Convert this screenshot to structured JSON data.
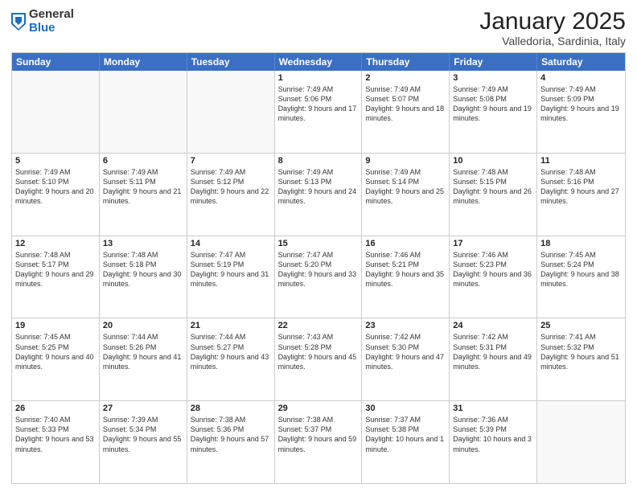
{
  "header": {
    "logo_general": "General",
    "logo_blue": "Blue",
    "month_title": "January 2025",
    "subtitle": "Valledoria, Sardinia, Italy"
  },
  "weekdays": [
    "Sunday",
    "Monday",
    "Tuesday",
    "Wednesday",
    "Thursday",
    "Friday",
    "Saturday"
  ],
  "weeks": [
    [
      {
        "day": "",
        "text": ""
      },
      {
        "day": "",
        "text": ""
      },
      {
        "day": "",
        "text": ""
      },
      {
        "day": "1",
        "text": "Sunrise: 7:49 AM\nSunset: 5:06 PM\nDaylight: 9 hours and 17 minutes."
      },
      {
        "day": "2",
        "text": "Sunrise: 7:49 AM\nSunset: 5:07 PM\nDaylight: 9 hours and 18 minutes."
      },
      {
        "day": "3",
        "text": "Sunrise: 7:49 AM\nSunset: 5:08 PM\nDaylight: 9 hours and 19 minutes."
      },
      {
        "day": "4",
        "text": "Sunrise: 7:49 AM\nSunset: 5:09 PM\nDaylight: 9 hours and 19 minutes."
      }
    ],
    [
      {
        "day": "5",
        "text": "Sunrise: 7:49 AM\nSunset: 5:10 PM\nDaylight: 9 hours and 20 minutes."
      },
      {
        "day": "6",
        "text": "Sunrise: 7:49 AM\nSunset: 5:11 PM\nDaylight: 9 hours and 21 minutes."
      },
      {
        "day": "7",
        "text": "Sunrise: 7:49 AM\nSunset: 5:12 PM\nDaylight: 9 hours and 22 minutes."
      },
      {
        "day": "8",
        "text": "Sunrise: 7:49 AM\nSunset: 5:13 PM\nDaylight: 9 hours and 24 minutes."
      },
      {
        "day": "9",
        "text": "Sunrise: 7:49 AM\nSunset: 5:14 PM\nDaylight: 9 hours and 25 minutes."
      },
      {
        "day": "10",
        "text": "Sunrise: 7:48 AM\nSunset: 5:15 PM\nDaylight: 9 hours and 26 minutes."
      },
      {
        "day": "11",
        "text": "Sunrise: 7:48 AM\nSunset: 5:16 PM\nDaylight: 9 hours and 27 minutes."
      }
    ],
    [
      {
        "day": "12",
        "text": "Sunrise: 7:48 AM\nSunset: 5:17 PM\nDaylight: 9 hours and 29 minutes."
      },
      {
        "day": "13",
        "text": "Sunrise: 7:48 AM\nSunset: 5:18 PM\nDaylight: 9 hours and 30 minutes."
      },
      {
        "day": "14",
        "text": "Sunrise: 7:47 AM\nSunset: 5:19 PM\nDaylight: 9 hours and 31 minutes."
      },
      {
        "day": "15",
        "text": "Sunrise: 7:47 AM\nSunset: 5:20 PM\nDaylight: 9 hours and 33 minutes."
      },
      {
        "day": "16",
        "text": "Sunrise: 7:46 AM\nSunset: 5:21 PM\nDaylight: 9 hours and 35 minutes."
      },
      {
        "day": "17",
        "text": "Sunrise: 7:46 AM\nSunset: 5:23 PM\nDaylight: 9 hours and 36 minutes."
      },
      {
        "day": "18",
        "text": "Sunrise: 7:45 AM\nSunset: 5:24 PM\nDaylight: 9 hours and 38 minutes."
      }
    ],
    [
      {
        "day": "19",
        "text": "Sunrise: 7:45 AM\nSunset: 5:25 PM\nDaylight: 9 hours and 40 minutes."
      },
      {
        "day": "20",
        "text": "Sunrise: 7:44 AM\nSunset: 5:26 PM\nDaylight: 9 hours and 41 minutes."
      },
      {
        "day": "21",
        "text": "Sunrise: 7:44 AM\nSunset: 5:27 PM\nDaylight: 9 hours and 43 minutes."
      },
      {
        "day": "22",
        "text": "Sunrise: 7:43 AM\nSunset: 5:28 PM\nDaylight: 9 hours and 45 minutes."
      },
      {
        "day": "23",
        "text": "Sunrise: 7:42 AM\nSunset: 5:30 PM\nDaylight: 9 hours and 47 minutes."
      },
      {
        "day": "24",
        "text": "Sunrise: 7:42 AM\nSunset: 5:31 PM\nDaylight: 9 hours and 49 minutes."
      },
      {
        "day": "25",
        "text": "Sunrise: 7:41 AM\nSunset: 5:32 PM\nDaylight: 9 hours and 51 minutes."
      }
    ],
    [
      {
        "day": "26",
        "text": "Sunrise: 7:40 AM\nSunset: 5:33 PM\nDaylight: 9 hours and 53 minutes."
      },
      {
        "day": "27",
        "text": "Sunrise: 7:39 AM\nSunset: 5:34 PM\nDaylight: 9 hours and 55 minutes."
      },
      {
        "day": "28",
        "text": "Sunrise: 7:38 AM\nSunset: 5:36 PM\nDaylight: 9 hours and 57 minutes."
      },
      {
        "day": "29",
        "text": "Sunrise: 7:38 AM\nSunset: 5:37 PM\nDaylight: 9 hours and 59 minutes."
      },
      {
        "day": "30",
        "text": "Sunrise: 7:37 AM\nSunset: 5:38 PM\nDaylight: 10 hours and 1 minute."
      },
      {
        "day": "31",
        "text": "Sunrise: 7:36 AM\nSunset: 5:39 PM\nDaylight: 10 hours and 3 minutes."
      },
      {
        "day": "",
        "text": ""
      }
    ]
  ]
}
